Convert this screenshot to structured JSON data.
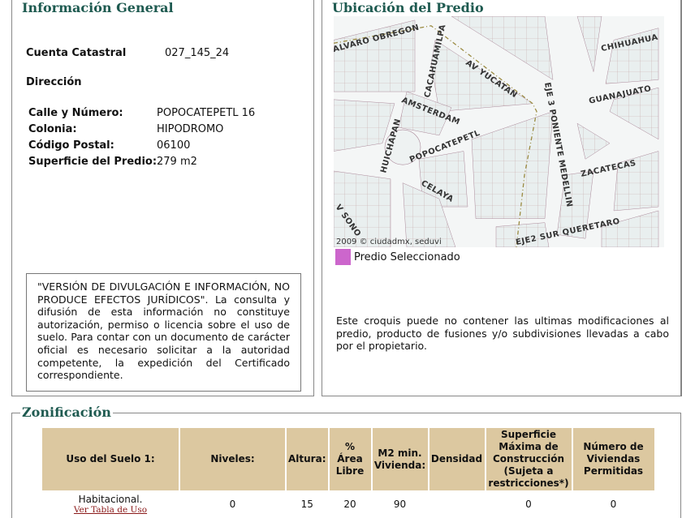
{
  "general": {
    "title": "Información General",
    "cuenta_label": "Cuenta Catastral",
    "cuenta_value": "027_145_24",
    "direccion_label": "Dirección",
    "fields": [
      {
        "label": "Calle y Número:",
        "value": "POPOCATEPETL 16"
      },
      {
        "label": "Colonia:",
        "value": "HIPODROMO"
      },
      {
        "label": "Código Postal:",
        "value": "06100"
      },
      {
        "label": "Superficie del Predio:",
        "value": "279 m2"
      }
    ],
    "disclaimer": "\"VERSIÓN DE DIVULGACIÓN E INFORMACIÓN, NO PRODUCE EFECTOS JURÍDICOS\". La consulta y difusión de esta información no constituye autorización, permiso o licencia sobre el uso de suelo. Para contar con un documento de carácter oficial es necesario solicitar a la autoridad competente, la expedición del Certificado correspondiente."
  },
  "ubicacion": {
    "title": "Ubicación del Predio",
    "streets": [
      "ALVARO OBREGON",
      "CACAHUAMILPA",
      "AV YUCATAN",
      "CHIHUAHUA",
      "GUANAJUATO",
      "AMSTERDAM",
      "EJE 3 PONIENTE MEDELLIN",
      "HUICHAPAN",
      "POPOCATEPETL",
      "ZACATECAS",
      "CELAYA",
      "EJE2 SUR QUERETARO",
      "V SONO"
    ],
    "copyright": "2009 © ciudadmx, seduvi",
    "legend": "Predio Seleccionado",
    "legend_color": "#cc66cc",
    "note": "Este croquis puede no contener las ultimas modificaciones al predio, producto de fusiones y/o subdivisiones llevadas a cabo por el propietario."
  },
  "zonificacion": {
    "title": "Zonificación",
    "headers": [
      "Uso del Suelo 1:",
      "Niveles:",
      "Altura:",
      "% Área Libre",
      "M2 min. Vivienda:",
      "Densidad",
      "Superficie Máxima de Construcción (Sujeta a restricciones*)",
      "Número de Viviendas Permitidas"
    ],
    "row": {
      "uso": "Habitacional.",
      "link": "Ver Tabla de Uso",
      "niveles": "0",
      "altura": "15",
      "area_libre": "20",
      "m2_min": "90",
      "densidad": "",
      "superficie": "0",
      "viviendas": "0"
    }
  }
}
